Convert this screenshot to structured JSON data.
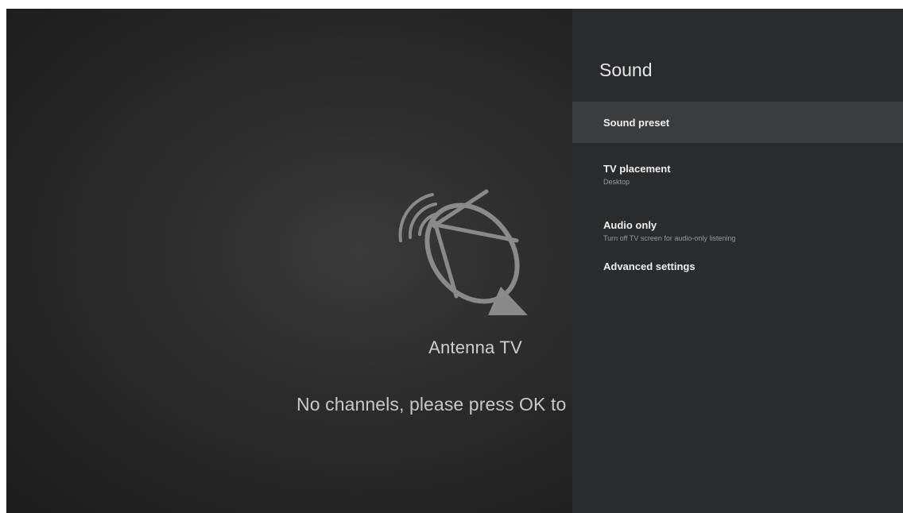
{
  "tv": {
    "source_name": "Antenna TV",
    "message": "No channels, please press OK to",
    "icon": "satellite-antenna-icon",
    "background_color": "#2e2e2e"
  },
  "panel": {
    "title": "Sound",
    "background_color": "#2a2b2d",
    "focus_color": "#3b3c3e",
    "items": [
      {
        "label": "Sound preset",
        "subtitle": ""
      },
      {
        "label": "TV placement",
        "subtitle": "Desktop"
      },
      {
        "label": "Audio only",
        "subtitle": "Turn off TV screen for audio-only listening"
      },
      {
        "label": "Advanced settings",
        "subtitle": ""
      }
    ],
    "focused_index": 0
  }
}
